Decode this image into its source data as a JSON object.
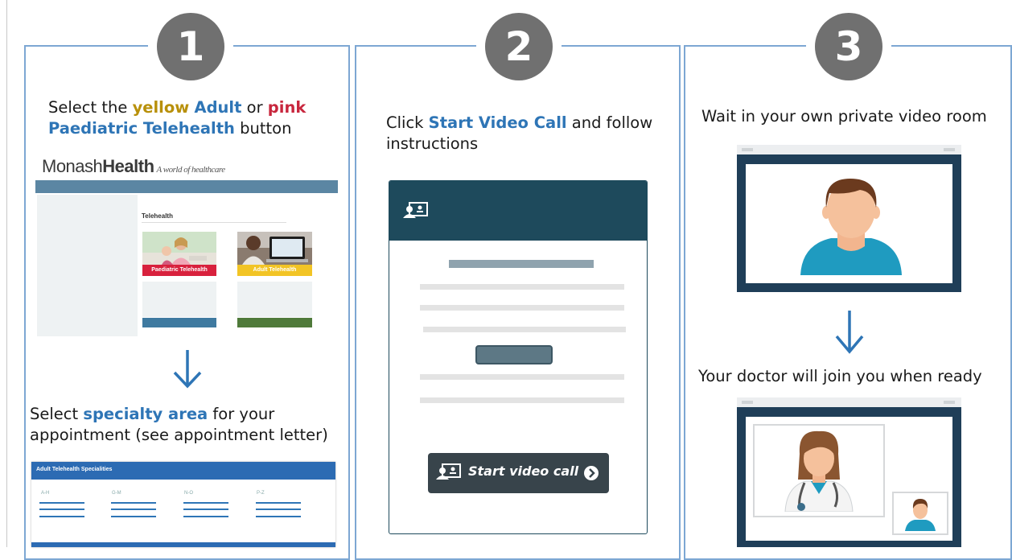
{
  "steps": [
    {
      "number": "1",
      "instruction": {
        "pre": "Select the ",
        "yellow": "yellow",
        "sp1": " ",
        "adult": "Adult",
        "or": " or ",
        "pink": "pink",
        "paediatric": "Paediatric Telehealth",
        "post": " button"
      },
      "site": {
        "logo_regular": "Monash",
        "logo_bold": "Health",
        "logo_tagline": "A world of healthcare",
        "page_heading": "Telehealth",
        "tiles": [
          {
            "label": "Paediatric Telehealth",
            "color": "#d8213d"
          },
          {
            "label": "Adult Telehealth",
            "color": "#f2c425"
          }
        ]
      },
      "second_instruction": {
        "pre": "Select ",
        "specialty": "specialty area",
        "post": " for your appointment (see appointment letter)"
      },
      "specialties": {
        "title": "Adult Telehealth Specialities",
        "columns": [
          "A-H",
          "G-M",
          "N-O",
          "P-Z"
        ]
      }
    },
    {
      "number": "2",
      "instruction": {
        "pre": "Click ",
        "highlight": "Start Video Call",
        "post": " and follow instructions"
      },
      "button_label": "Start video call"
    },
    {
      "number": "3",
      "instruction_top": "Wait in your own private video room",
      "instruction_bottom": "Your doctor will join you when ready"
    }
  ],
  "colors": {
    "panel_border": "#7da7d3",
    "badge": "#707070",
    "accent_blue": "#2e75b6",
    "video_header": "#1e4a5c",
    "video_frame": "#1f3e58"
  }
}
